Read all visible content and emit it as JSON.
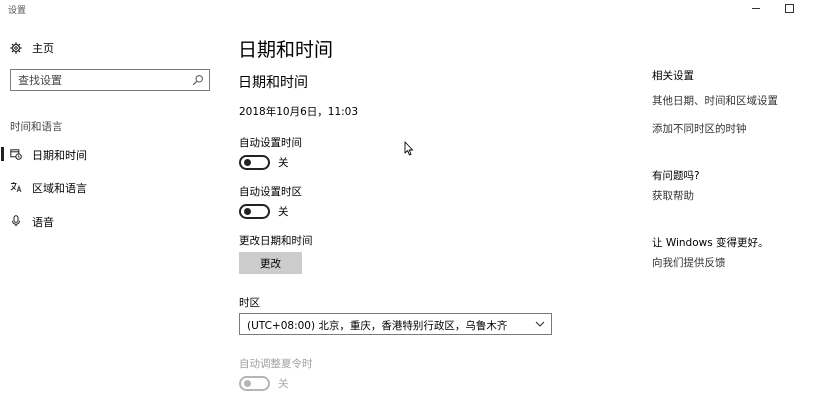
{
  "window": {
    "title": "设置"
  },
  "sidebar": {
    "home_label": "主页",
    "search_placeholder": "查找设置",
    "section_title": "时间和语言",
    "items": [
      {
        "label": "日期和时间",
        "icon": "calendar-clock-icon",
        "active": true
      },
      {
        "label": "区域和语言",
        "icon": "language-icon",
        "active": false
      },
      {
        "label": "语音",
        "icon": "microphone-icon",
        "active": false
      }
    ]
  },
  "main": {
    "page_title": "日期和时间",
    "section_title": "日期和时间",
    "current_datetime": "2018年10月6日，11:03",
    "auto_time": {
      "label": "自动设置时间",
      "state": "关"
    },
    "auto_timezone": {
      "label": "自动设置时区",
      "state": "关"
    },
    "change_datetime": {
      "label": "更改日期和时间",
      "button": "更改"
    },
    "timezone": {
      "label": "时区",
      "value": "(UTC+08:00) 北京，重庆，香港特别行政区，乌鲁木齐"
    },
    "dst": {
      "label": "自动调整夏令时",
      "state": "关"
    }
  },
  "related": {
    "heading": "相关设置",
    "links": [
      "其他日期、时间和区域设置",
      "添加不同时区的时钟"
    ],
    "help_heading": "有问题吗?",
    "help_link": "获取帮助",
    "feedback_heading": "让 Windows 变得更好。",
    "feedback_link": "向我们提供反馈"
  },
  "colors": {
    "accent": "#000000",
    "button_bg": "#cccccc",
    "disabled": "#a8a8a8"
  }
}
